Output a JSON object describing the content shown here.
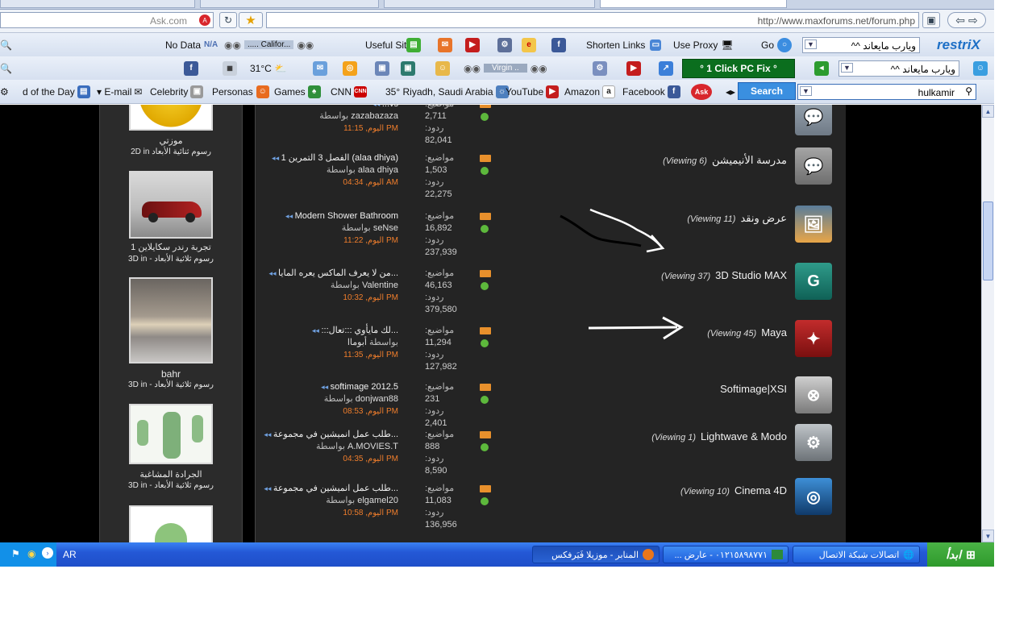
{
  "browser": {
    "search_engine_placeholder": "Ask.com",
    "url": "http://www.maxforums.net/forum.php"
  },
  "toolbar1": {
    "no_data": "No Data",
    "radio_station": "..... Califor...",
    "useful_sites": "Useful Sites",
    "shorten_links": "Shorten Links",
    "use_proxy": "Use Proxy",
    "go": "Go",
    "search_value": "ويارب مايعاند ^^",
    "brand": "restriX"
  },
  "toolbar2": {
    "temperature": "31°C",
    "radio": "Virgin ..",
    "pc_fix": "° 1 Click PC Fix °",
    "search_value": "ويارب مايعاند ^^"
  },
  "toolbar3": {
    "items": [
      "d of the Day",
      "E-mail",
      "Celebrity",
      "Personas",
      "Games",
      "CNN",
      "35° Riyadh, Saudi Arabia",
      "YouTube",
      "Amazon",
      "Facebook"
    ],
    "search_button": "Search",
    "user": "hulkamir"
  },
  "sidebar": {
    "items": [
      {
        "caption": "موزتي",
        "category": "رسوم ثنائية الأبعاد 2D"
      },
      {
        "caption": "تجربة رندر سكايلاين 1",
        "category": "رسوم ثلاثية الأبعاد - 3D"
      },
      {
        "caption": "bahr",
        "category": "رسوم ثلاثية الأبعاد - 3D"
      },
      {
        "caption": "الجرادة المشاغبة",
        "category": "رسوم ثلاثية الأبعاد - 3D"
      }
    ],
    "in_label": "in"
  },
  "labels": {
    "topics": "مواضيع:",
    "replies": "ردود:",
    "by": "بواسطة",
    "today": "اليوم,"
  },
  "forums": [
    {
      "name": "",
      "viewing": "",
      "title": "...vs",
      "author": "zazabazaza",
      "time": "11:15 PM",
      "topics": "2,711",
      "replies": "82,041"
    },
    {
      "name": "مدرسة الأنيميشن",
      "viewing": "(Viewing 6)",
      "title": "الفصل 3 التمرين 1 (alaa dhiya)",
      "author": "alaa dhiya",
      "time": "04:34 AM",
      "topics": "1,503",
      "replies": "22,275"
    },
    {
      "name": "عرض ونقد",
      "viewing": "(Viewing 11)",
      "title": "Modern Shower Bathroom",
      "author": "seNse",
      "time": "11:22 PM",
      "topics": "16,892",
      "replies": "237,939"
    },
    {
      "name": "3D Studio MAX",
      "viewing": "(Viewing 37)",
      "title": "من لا يعرف الماكس يعره المايا...",
      "author": "Valentine",
      "time": "10:32 PM",
      "topics": "46,163",
      "replies": "379,580"
    },
    {
      "name": "Maya",
      "viewing": "(Viewing 45)",
      "title": ":::لك مايأوي :::تعال...",
      "author": "أبوماا",
      "time": "11:35 PM",
      "topics": "11,294",
      "replies": "127,982"
    },
    {
      "name": "Softimage|XSI",
      "viewing": "",
      "title": "softimage 2012.5",
      "author": "donjwan88",
      "time": "08:53 PM",
      "topics": "231",
      "replies": "2,401"
    },
    {
      "name": "Lightwave & Modo",
      "viewing": "(Viewing 1)",
      "title": "طلب عمل انميشين في مجموعة...",
      "author": "A.MOVIES.T",
      "time": "04:35 PM",
      "topics": "888",
      "replies": "8,590"
    },
    {
      "name": "Cinema 4D",
      "viewing": "(Viewing 10)",
      "title": "طلب عمل انميشين في مجموعة...",
      "author": "elgamel20",
      "time": "10:58 PM",
      "topics": "11,083",
      "replies": "136,956"
    }
  ],
  "taskbar": {
    "start": "ابدأ",
    "window1": "اتصالات شبكة الاتصال",
    "window2": "٠١٢١٥٨٩٨٧٧١ - عارض ...",
    "window3": "المنابر - موزيلا فَيَرفكس",
    "lang": "AR"
  }
}
